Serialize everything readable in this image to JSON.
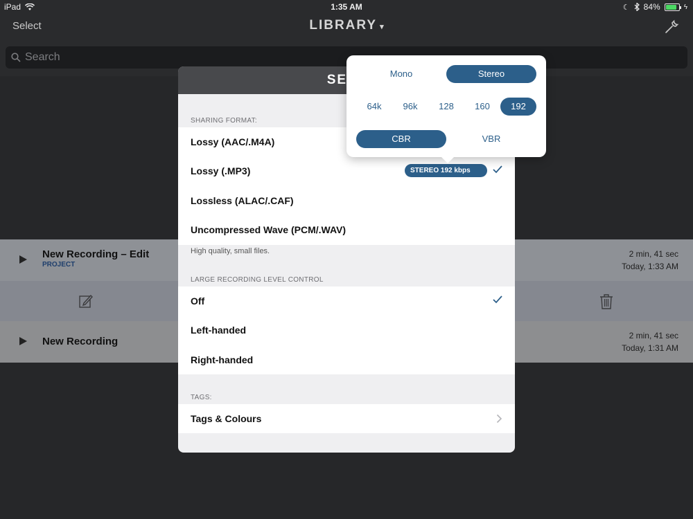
{
  "status_bar": {
    "device": "iPad",
    "time": "1:35 AM",
    "battery": "84%",
    "battery_level": 0.84
  },
  "navbar": {
    "select_label": "Select",
    "title": "LIBRARY",
    "title_caret": "▾"
  },
  "search": {
    "placeholder": "Search"
  },
  "recordings": [
    {
      "title": "New Recording – Edit",
      "subtitle": "PROJECT",
      "duration": "2 min, 41 sec",
      "date": "Today, 1:33 AM"
    },
    {
      "title": "New Recording",
      "subtitle": "",
      "duration": "2 min, 41 sec",
      "date": "Today, 1:31 AM"
    }
  ],
  "settings": {
    "title": "SETT",
    "sharing_format": {
      "section_label": "SHARING FORMAT:",
      "items": [
        "Lossy (AAC/.M4A)",
        "Lossy (.MP3)",
        "Lossless (ALAC/.CAF)",
        "Uncompressed Wave (PCM/.WAV)"
      ],
      "selected_format_pill": "STEREO 192 kbps CBR ▾",
      "hint": "High quality, small files."
    },
    "level_control": {
      "section_label": "LARGE RECORDING LEVEL CONTROL",
      "items": [
        "Off",
        "Left-handed",
        "Right-handed"
      ]
    },
    "tags": {
      "section_label": "TAGS:",
      "item": "Tags & Colours"
    }
  },
  "popover": {
    "channels": [
      "Mono",
      "Stereo"
    ],
    "channels_selected": "Stereo",
    "bitrates": [
      "64k",
      "96k",
      "128",
      "160",
      "192"
    ],
    "bitrate_selected": "192",
    "modes": [
      "CBR",
      "VBR"
    ],
    "mode_selected": "CBR"
  },
  "colors": {
    "accent": "#2c5f8a",
    "battery_green": "#4cd964"
  }
}
